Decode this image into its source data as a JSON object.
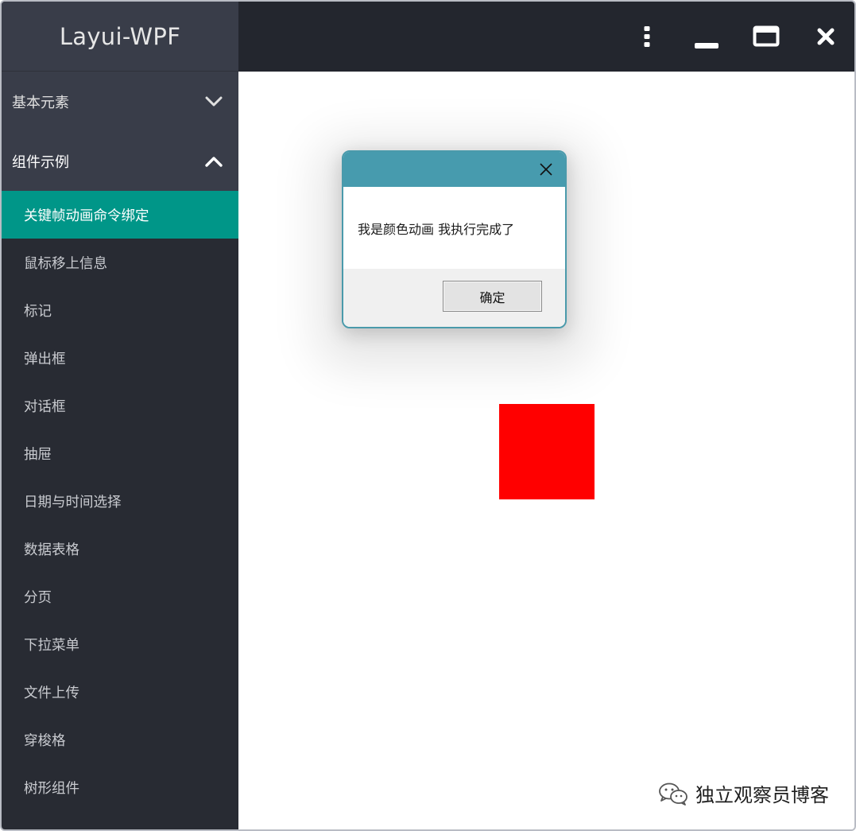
{
  "app": {
    "title": "Layui-WPF"
  },
  "sidebar": {
    "groups": [
      {
        "label": "基本元素",
        "state": "collapsed",
        "icon": "chevron-down-icon"
      },
      {
        "label": "组件示例",
        "state": "expanded",
        "icon": "chevron-up-icon"
      }
    ],
    "items": [
      {
        "label": "关键帧动画命令绑定",
        "active": true
      },
      {
        "label": "鼠标移上信息"
      },
      {
        "label": "标记"
      },
      {
        "label": "弹出框"
      },
      {
        "label": "对话框"
      },
      {
        "label": "抽屉"
      },
      {
        "label": "日期与时间选择"
      },
      {
        "label": "数据表格"
      },
      {
        "label": "分页"
      },
      {
        "label": "下拉菜单"
      },
      {
        "label": "文件上传"
      },
      {
        "label": "穿梭格"
      },
      {
        "label": "树形组件"
      }
    ]
  },
  "titlebar": {
    "buttons": [
      "more-icon",
      "minimize-icon",
      "maximize-icon",
      "close-icon"
    ]
  },
  "dialog": {
    "message": "我是颜色动画 我执行完成了",
    "ok_label": "确定"
  },
  "watermark": {
    "text": "独立观察员博客"
  },
  "colors": {
    "sidebar_bg": "#282b33",
    "brand_bg": "#393d49",
    "active_item": "#009688",
    "titlebar_bg": "#23262e",
    "dialog_header": "#479bae",
    "square": "#ff0000"
  }
}
